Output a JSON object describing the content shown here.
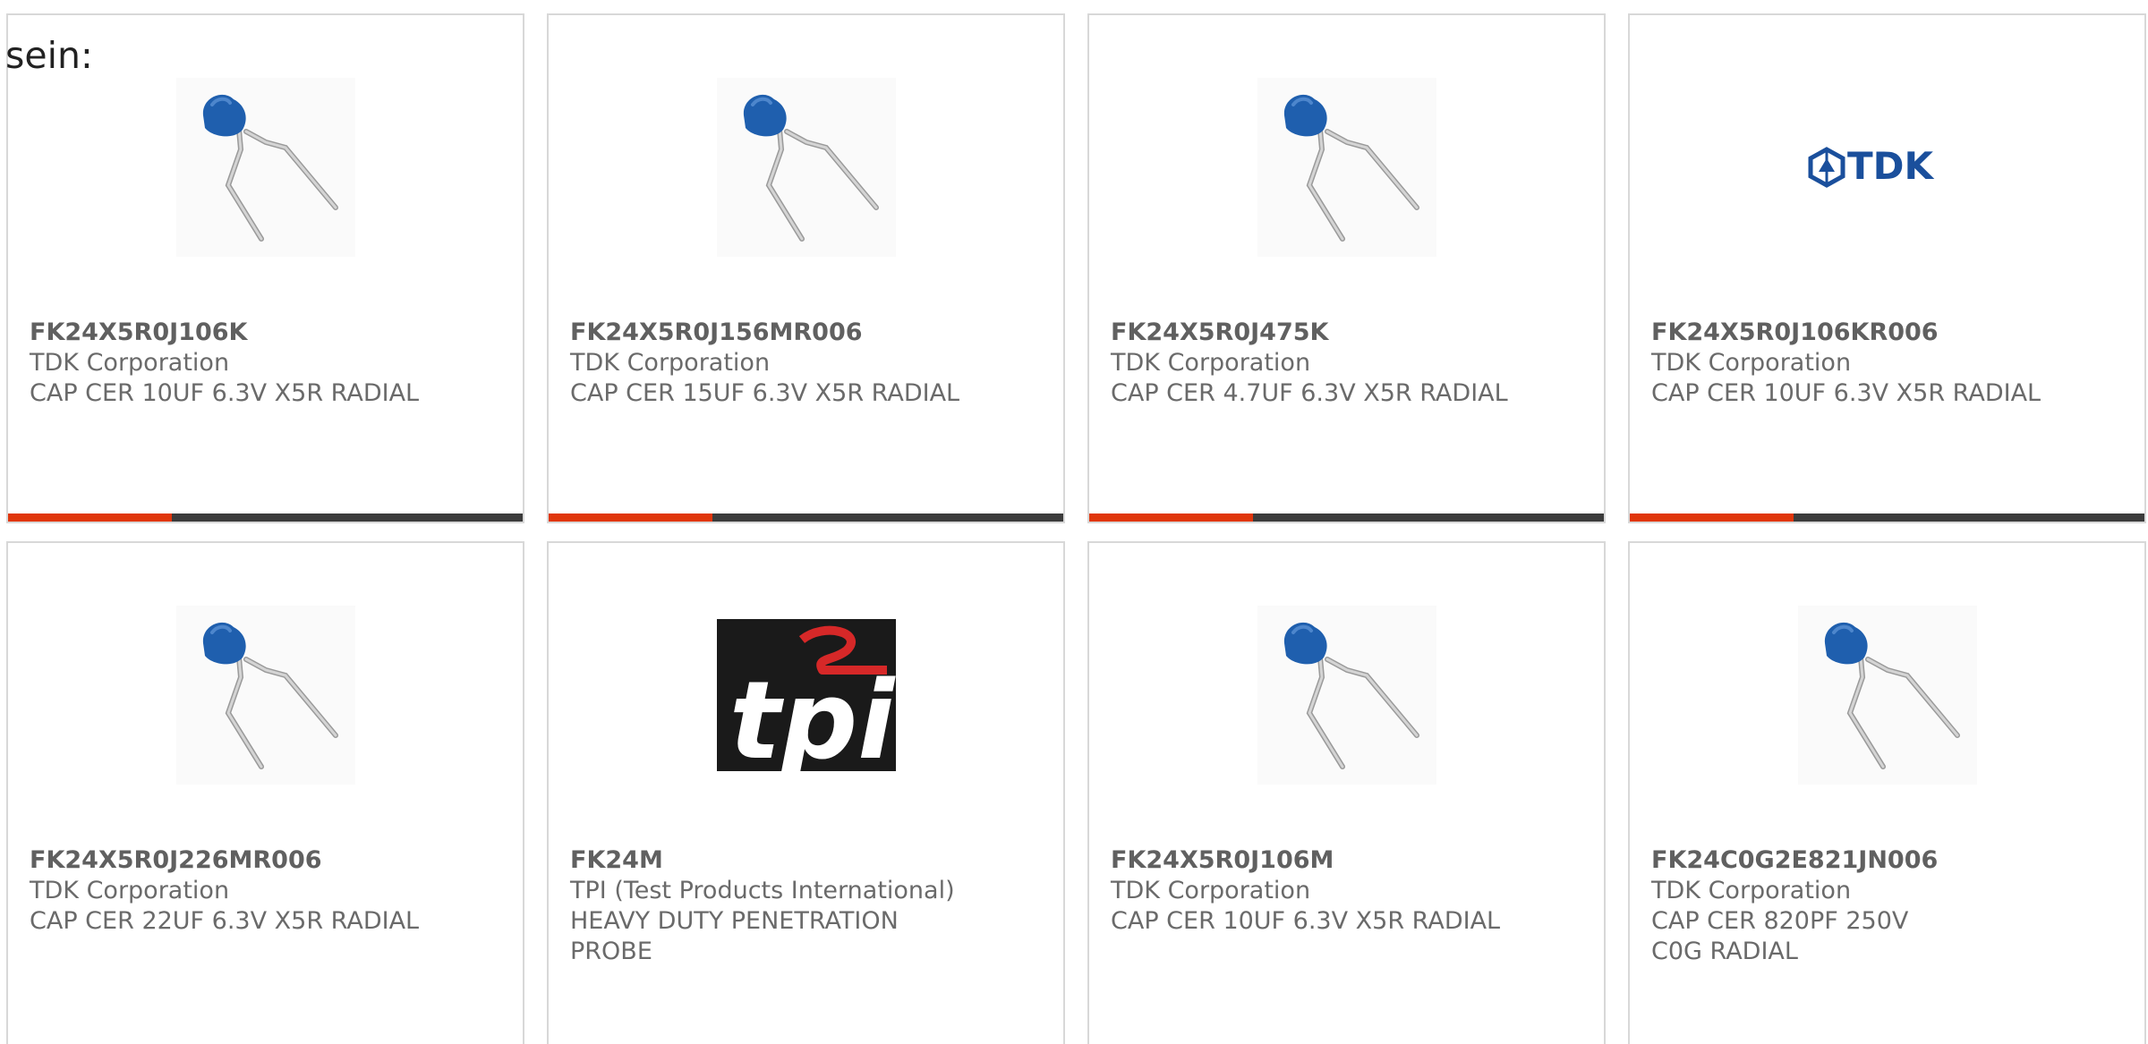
{
  "intro_text": "sein:",
  "colors": {
    "accent": "#e0360b",
    "bar_dark": "#3c3c3c",
    "capacitor_blue": "#1f5fae",
    "tdk_blue": "#1a4f9c",
    "tpi_red": "#d62828"
  },
  "products": [
    {
      "part_number": "FK24X5R0J106K",
      "manufacturer": "TDK Corporation",
      "description": "CAP CER 10UF 6.3V X5R RADIAL",
      "image": "radial-capacitor-icon"
    },
    {
      "part_number": "FK24X5R0J156MR006",
      "manufacturer": "TDK Corporation",
      "description": "CAP CER 15UF 6.3V X5R RADIAL",
      "image": "radial-capacitor-icon"
    },
    {
      "part_number": "FK24X5R0J475K",
      "manufacturer": "TDK Corporation",
      "description": "CAP CER 4.7UF 6.3V X5R RADIAL",
      "image": "radial-capacitor-icon"
    },
    {
      "part_number": "FK24X5R0J106KR006",
      "manufacturer": "TDK Corporation",
      "description": "CAP CER 10UF 6.3V X5R RADIAL",
      "image": "tdk-logo",
      "logo_text": "TDK"
    },
    {
      "part_number": "FK24X5R0J226MR006",
      "manufacturer": "TDK Corporation",
      "description": "CAP CER 22UF 6.3V X5R RADIAL",
      "image": "radial-capacitor-icon"
    },
    {
      "part_number": "FK24M",
      "manufacturer": "TPI (Test Products International)",
      "description": "HEAVY DUTY PENETRATION PROBE",
      "image": "tpi-logo",
      "logo_text": "tpi"
    },
    {
      "part_number": "FK24X5R0J106M",
      "manufacturer": "TDK Corporation",
      "description": "CAP CER 10UF 6.3V X5R RADIAL",
      "image": "radial-capacitor-icon"
    },
    {
      "part_number": "FK24C0G2E821JN006",
      "manufacturer": "TDK Corporation",
      "description": "CAP CER 820PF 250V C0G RADIAL",
      "image": "radial-capacitor-icon"
    }
  ]
}
